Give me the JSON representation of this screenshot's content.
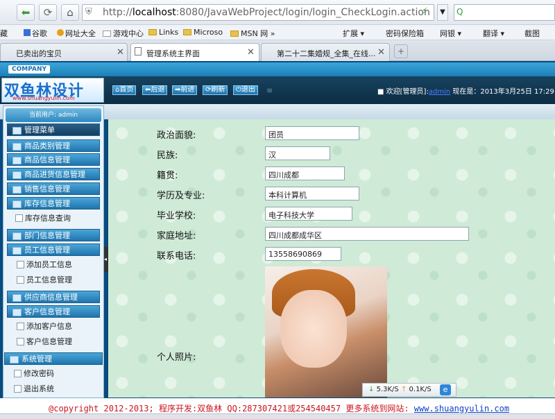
{
  "browser": {
    "url_prefix": "http://",
    "url_host": "localhost",
    "url_rest": ":8080/JavaWebProject/login/login_CheckLogin.action",
    "bookmarks": [
      "藏",
      "谷歌",
      "网址大全",
      "游戏中心",
      "Links",
      "Microso",
      "MSN 网",
      "扩展",
      "密码保险箱",
      "网银",
      "翻译",
      "截图"
    ],
    "tabs": [
      {
        "label": "已卖出的宝贝",
        "active": false
      },
      {
        "label": "管理系统主界面",
        "active": true
      },
      {
        "label": "第二十二集婚规_全集_在线...",
        "active": false
      }
    ],
    "new_tab": "+"
  },
  "app": {
    "company_label": "COMPANY",
    "logo_text": "双鱼林设计",
    "logo_url": "www.shuangyulin.com",
    "toolbar": {
      "home": "首页",
      "back": "后退",
      "forward": "前进",
      "refresh": "刷新",
      "logout": "退出"
    },
    "welcome_prefix": "欢迎[管理员]:",
    "welcome_user": "admin",
    "welcome_suffix": " 现在是：2013年3月25日 17:29"
  },
  "sidebar": {
    "current_user": "当前用户: admin",
    "menu_title": "管理菜单",
    "items": [
      {
        "label": "商品类别管理"
      },
      {
        "label": "商品信息管理"
      },
      {
        "label": "商品进货信息管理"
      },
      {
        "label": "销售信息管理"
      },
      {
        "label": "库存信息管理"
      },
      {
        "label": "库存信息查询"
      },
      {
        "label": "部门信息管理"
      },
      {
        "label": "员工信息管理"
      },
      {
        "label": "添加员工信息"
      },
      {
        "label": "员工信息管理"
      },
      {
        "label": "供应商信息管理"
      },
      {
        "label": "客户信息管理"
      },
      {
        "label": "添加客户信息"
      },
      {
        "label": "客户信息管理"
      },
      {
        "label": "系统管理"
      },
      {
        "label": "修改密码"
      },
      {
        "label": "退出系统"
      }
    ]
  },
  "form": {
    "political": {
      "label": "政治面貌:",
      "value": "团员"
    },
    "nation": {
      "label": "民族:",
      "value": "汉"
    },
    "origin": {
      "label": "籍贯:",
      "value": "四川成都"
    },
    "education": {
      "label": "学历及专业:",
      "value": "本科计算机"
    },
    "school": {
      "label": "毕业学校:",
      "value": "电子科技大学"
    },
    "address": {
      "label": "家庭地址:",
      "value": "四川成都成华区"
    },
    "phone": {
      "label": "联系电话:",
      "value": "13558690869"
    },
    "photo_label": "个人照片:"
  },
  "netstat": {
    "down": "5.3K/S",
    "up": "0.1K/S"
  },
  "footer": {
    "copyright": "@copyright 2012-2013; 程序开发:双鱼林  QQ:287307421或254540457  更多系统到网站: ",
    "site": "www.shuangyulin.com"
  }
}
